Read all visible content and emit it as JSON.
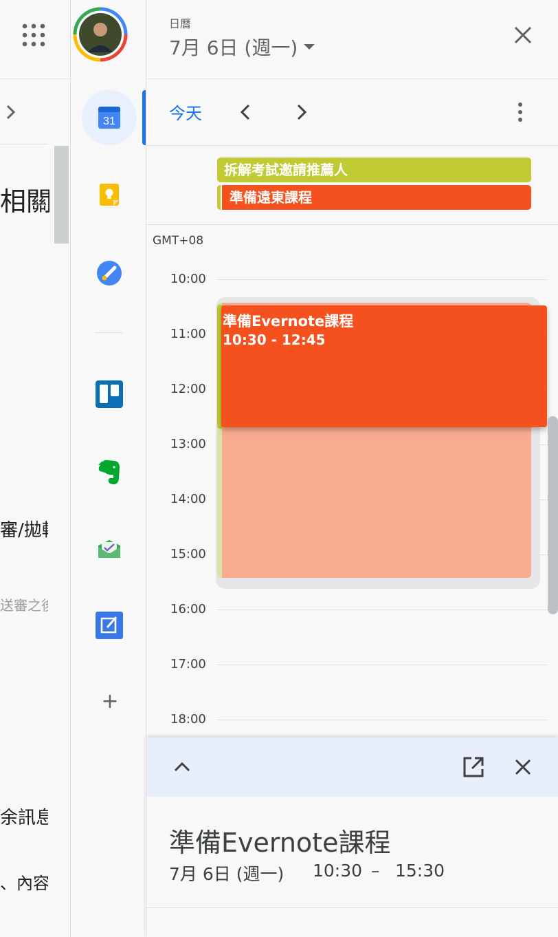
{
  "document": {
    "heading_fragment": "相關",
    "line_fragment_1": "審/拋轉",
    "line_fragment_2": "送審之後",
    "line_fragment_3": "余訊息",
    "line_fragment_4": "、內容"
  },
  "side_panel": {
    "calendar_icon_day": "31",
    "add_label": "+"
  },
  "header": {
    "app_title": "日曆",
    "date_label": "7月 6日 (週一)"
  },
  "nav": {
    "today_label": "今天"
  },
  "all_day_events": [
    {
      "title": "拆解考試邀請推薦人",
      "color": "#c0ca33"
    },
    {
      "title": "準備遠東課程",
      "color": "#f4511e"
    }
  ],
  "timeline": {
    "timezone": "GMT+08",
    "hours": [
      "10:00",
      "11:00",
      "12:00",
      "13:00",
      "14:00",
      "15:00",
      "16:00",
      "17:00",
      "18:00"
    ]
  },
  "dragged_event": {
    "title": "準備Evernote課程",
    "time_label": "10:30 - 12:45",
    "color": "#f4511e"
  },
  "details": {
    "title": "準備Evernote課程",
    "date": "7月 6日 (週一)",
    "start": "10:30",
    "dash": "–",
    "end": "15:30"
  },
  "colors": {
    "accent": "#1a73e8",
    "tomato": "#f4511e",
    "citron": "#c0ca33"
  }
}
